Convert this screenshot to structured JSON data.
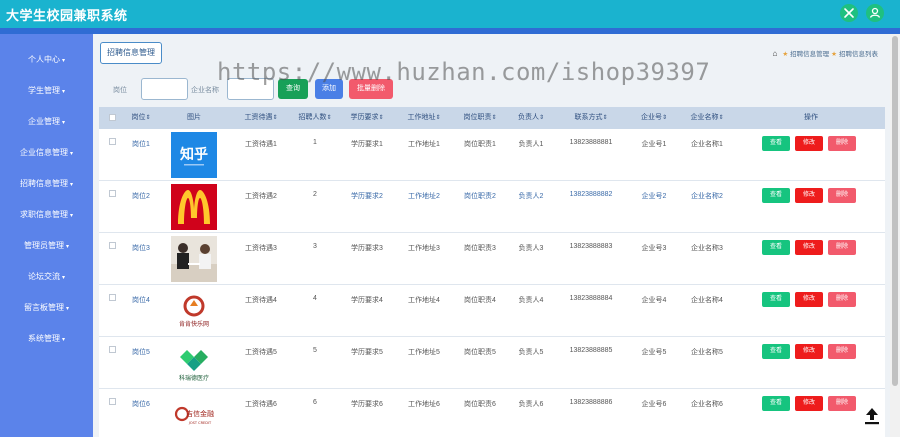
{
  "app": {
    "title": "大学生校园兼职系统"
  },
  "topbar": {
    "icon1": "expand-icon",
    "icon2": "user-icon",
    "accent": "#1ab3cf"
  },
  "sidebar": {
    "items": [
      {
        "label": "个人中心"
      },
      {
        "label": "学生管理"
      },
      {
        "label": "企业管理"
      },
      {
        "label": "企业信息管理"
      },
      {
        "label": "招聘信息管理"
      },
      {
        "label": "求职信息管理"
      },
      {
        "label": "管理员管理"
      },
      {
        "label": "论坛交流"
      },
      {
        "label": "留言板管理"
      },
      {
        "label": "系统管理"
      }
    ]
  },
  "page": {
    "tab": "招聘信息管理",
    "breadcrumb": {
      "level1": "招聘信息管理",
      "level2": "招聘信息列表"
    }
  },
  "search": {
    "label_position": "岗位",
    "label_company": "企业名称",
    "position_value": "",
    "company_value": "",
    "btn_search": "查询",
    "btn_add": "添加",
    "btn_batch_delete": "批量删除"
  },
  "watermark": "https://www.huzhan.com/ishop39397",
  "table": {
    "headers": {
      "position": "岗位",
      "picture": "图片",
      "salary": "工资待遇",
      "headcount": "招聘人数",
      "education": "学历要求",
      "address": "工作地址",
      "duties": "岗位职责",
      "contact_person": "负责人",
      "phone": "联系方式",
      "company_no": "企业号",
      "company_name": "企业名称",
      "actions": "操作"
    },
    "sort_icon": "sort-icon",
    "rows": [
      {
        "position": "岗位1",
        "image": "zhihu-logo",
        "image_text": "知乎",
        "salary": "工资待遇1",
        "headcount": "1",
        "education": "学历要求1",
        "address": "工作地址1",
        "duties": "岗位职责1",
        "contact_person": "负责人1",
        "phone": "13823888881",
        "company_no": "企业号1",
        "company_name": "企业名称1"
      },
      {
        "position": "岗位2",
        "image": "mcdonalds-logo",
        "image_text": "M",
        "salary": "工资待遇2",
        "headcount": "2",
        "education": "学历要求2",
        "address": "工作地址2",
        "duties": "岗位职责2",
        "contact_person": "负责人2",
        "phone": "13823888882",
        "company_no": "企业号2",
        "company_name": "企业名称2"
      },
      {
        "position": "岗位3",
        "image": "office-photo",
        "image_text": "",
        "salary": "工资待遇3",
        "headcount": "3",
        "education": "学历要求3",
        "address": "工作地址3",
        "duties": "岗位职责3",
        "contact_person": "负责人3",
        "phone": "13823888883",
        "company_no": "企业号3",
        "company_name": "企业名称3"
      },
      {
        "position": "岗位4",
        "image": "company-logo-red",
        "image_text": "肯肯快乐网",
        "salary": "工资待遇4",
        "headcount": "4",
        "education": "学历要求4",
        "address": "工作地址4",
        "duties": "岗位职责4",
        "contact_person": "负责人4",
        "phone": "13823888884",
        "company_no": "企业号4",
        "company_name": "企业名称4"
      },
      {
        "position": "岗位5",
        "image": "company-logo-green",
        "image_text": "科瑞德医疗",
        "salary": "工资待遇5",
        "headcount": "5",
        "education": "学历要求5",
        "address": "工作地址5",
        "duties": "岗位职责5",
        "contact_person": "负责人5",
        "phone": "13823888885",
        "company_no": "企业号5",
        "company_name": "企业名称5"
      },
      {
        "position": "岗位6",
        "image": "jixin-finance-logo",
        "image_text": "吉信金融",
        "image_subtext": "JOST CREDIT",
        "salary": "工资待遇6",
        "headcount": "6",
        "education": "学历要求6",
        "address": "工作地址6",
        "duties": "岗位职责6",
        "contact_person": "负责人6",
        "phone": "13823888886",
        "company_no": "企业号6",
        "company_name": "企业名称6"
      }
    ],
    "actions": {
      "view": "查看",
      "edit": "修改",
      "delete": "删除"
    }
  },
  "colors": {
    "sidebar": "#5b83ea",
    "view": "#16c47f",
    "edit": "#ee1c1c",
    "delete": "#f25a6c",
    "search": "#18a058",
    "add": "#4a7fe6"
  }
}
